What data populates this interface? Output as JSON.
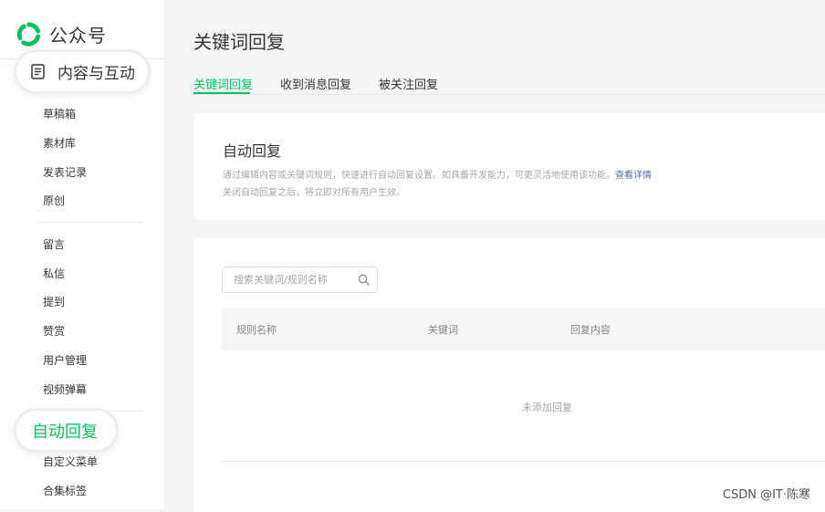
{
  "app": {
    "logo_text": "公众号",
    "logo_icon": "wechat-official-account-logo",
    "brand_color": "#07c160",
    "link_color": "#576b95"
  },
  "sidebar": {
    "section_content": {
      "label": "内容与互动",
      "icon": "document-icon"
    },
    "content_items": [
      {
        "label": "草稿箱"
      },
      {
        "label": "素材库"
      },
      {
        "label": "发表记录"
      },
      {
        "label": "原创"
      }
    ],
    "interaction_items": [
      {
        "label": "留言"
      },
      {
        "label": "私信"
      },
      {
        "label": "提到"
      },
      {
        "label": "赞赏"
      },
      {
        "label": "用户管理"
      },
      {
        "label": "视频弹幕"
      }
    ],
    "section_auto_reply": {
      "label": "自动回复"
    },
    "feature_items": [
      {
        "label": "自定义菜单"
      },
      {
        "label": "合集标签"
      }
    ]
  },
  "main": {
    "title": "关键词回复",
    "tabs": [
      {
        "label": "关键词回复",
        "active": true
      },
      {
        "label": "收到消息回复",
        "active": false
      },
      {
        "label": "被关注回复",
        "active": false
      }
    ],
    "auto_reply_card": {
      "title": "自动回复",
      "desc_line1": "通过编辑内容或关键词规则，快速进行自动回复设置。如具备开发能力，可更灵活地使用该功能。",
      "detail_link": "查看详情",
      "desc_line2": "关闭自动回复之后，将立即对所有用户生效。"
    },
    "rules": {
      "search_placeholder": "搜索关键词/规则名称",
      "search_value": "",
      "columns": [
        "规则名称",
        "关键词",
        "回复内容"
      ],
      "rows": [],
      "empty_text": "未添加回复"
    }
  },
  "watermark": "CSDN @IT·陈寒"
}
